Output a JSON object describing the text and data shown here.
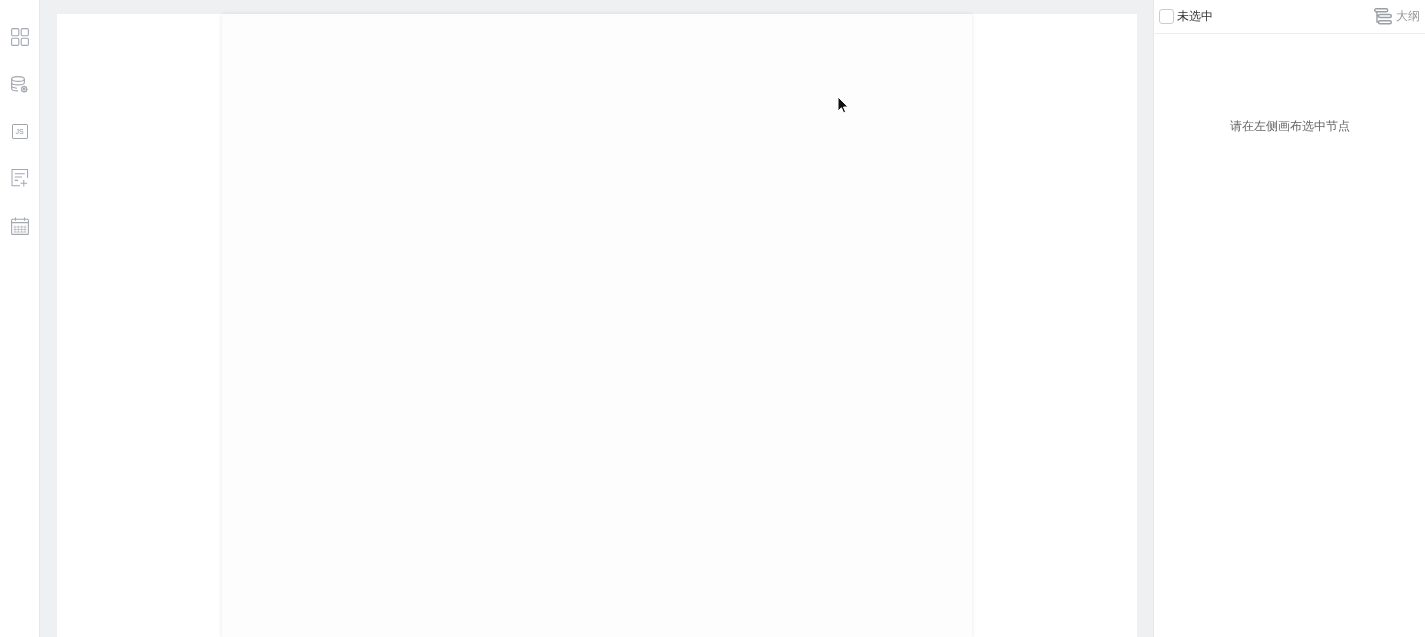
{
  "sidebar": {
    "items": [
      {
        "kind": "grid"
      },
      {
        "kind": "database"
      },
      {
        "kind": "script",
        "text": "JS"
      },
      {
        "kind": "form"
      },
      {
        "kind": "calendar"
      }
    ]
  },
  "panel": {
    "select_all": {
      "checked": false,
      "label": "未选中"
    },
    "outline_button": {
      "label": "大纲"
    },
    "empty_message": "请在左侧画布选中节点"
  }
}
